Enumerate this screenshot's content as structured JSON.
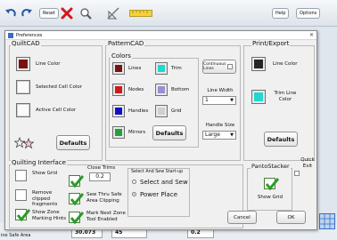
{
  "app_toolbar": {
    "undo_icon": "undo-icon",
    "redo_icon": "redo-icon",
    "reset_label": "Reset",
    "help_label": "Help",
    "options_label": "Options"
  },
  "dialog": {
    "title": "Preferences"
  },
  "quiltcad": {
    "title": "QuiltCAD",
    "line_color_label": "Line Color",
    "selected_cell_color_label": "Selected Cell Color",
    "active_cell_color_label": "Active Cell Color",
    "defaults_label": "Defaults",
    "colors": {
      "line": "#7a1212",
      "selected": "#f7f7f7",
      "active": "#fafafa"
    }
  },
  "patterncad": {
    "title": "PatternCAD",
    "colors_title": "Colors",
    "lines_label": "Lines",
    "trim_label": "Trim",
    "nodes_label": "Nodes",
    "bottom_label": "Bottom",
    "handles_label": "Handles",
    "grid_label": "Grid",
    "mirrors_label": "Mirrors",
    "defaults_label": "Defaults",
    "continuous_lines_label": "Continuous Lines",
    "line_width_label": "Line Width",
    "line_width_value": "1",
    "handle_size_label": "Handle Size",
    "handle_size_value": "Large",
    "colors": {
      "lines": "#7a1212",
      "trim": "#20d8d0",
      "nodes": "#d21818",
      "bottom": "#9a8fd4",
      "handles": "#1010c8",
      "grid": "#d0d0d0",
      "mirrors": "#22a040"
    }
  },
  "print_export": {
    "title": "Print/Export",
    "line_color_label": "Line Color",
    "trim_line_color_label": "Trim Line Color",
    "defaults_label": "Defaults",
    "colors": {
      "line": "#262626",
      "trim": "#20d8d0"
    }
  },
  "quilting_interface": {
    "title": "Quilting Interface",
    "show_grid_label": "Show Grid",
    "remove_clipped_label": "Remove clipped fragments",
    "show_zone_label": "Show Zone Marking Hints",
    "close_trims_label": "Close Trims",
    "close_trims_value": "0.2",
    "sew_thru_label": "Sew Thru Safe Area Clipping",
    "mark_next_zone_label": "Mark Next Zone Tool Enabled",
    "startup_title": "Select And Sew Start-up",
    "startup_options": [
      "Select and Sew",
      "Power Place"
    ],
    "startup_selected": "Power Place",
    "checks": {
      "show_grid": false,
      "remove_clipped": false,
      "show_zone": true,
      "close_trims": true,
      "sew_thru": true,
      "mark_next_zone": true
    }
  },
  "pantostacker": {
    "title": "PantoStacker",
    "show_grid_label": "Show Grid",
    "show_grid_checked": true
  },
  "quick_exit_label": "Quick Exit",
  "cancel_label": "Cancel",
  "ok_label": "OK",
  "background": {
    "status_left": "ine Safe Area",
    "value1": "30.073",
    "value2": "45",
    "value3": "0.2"
  }
}
